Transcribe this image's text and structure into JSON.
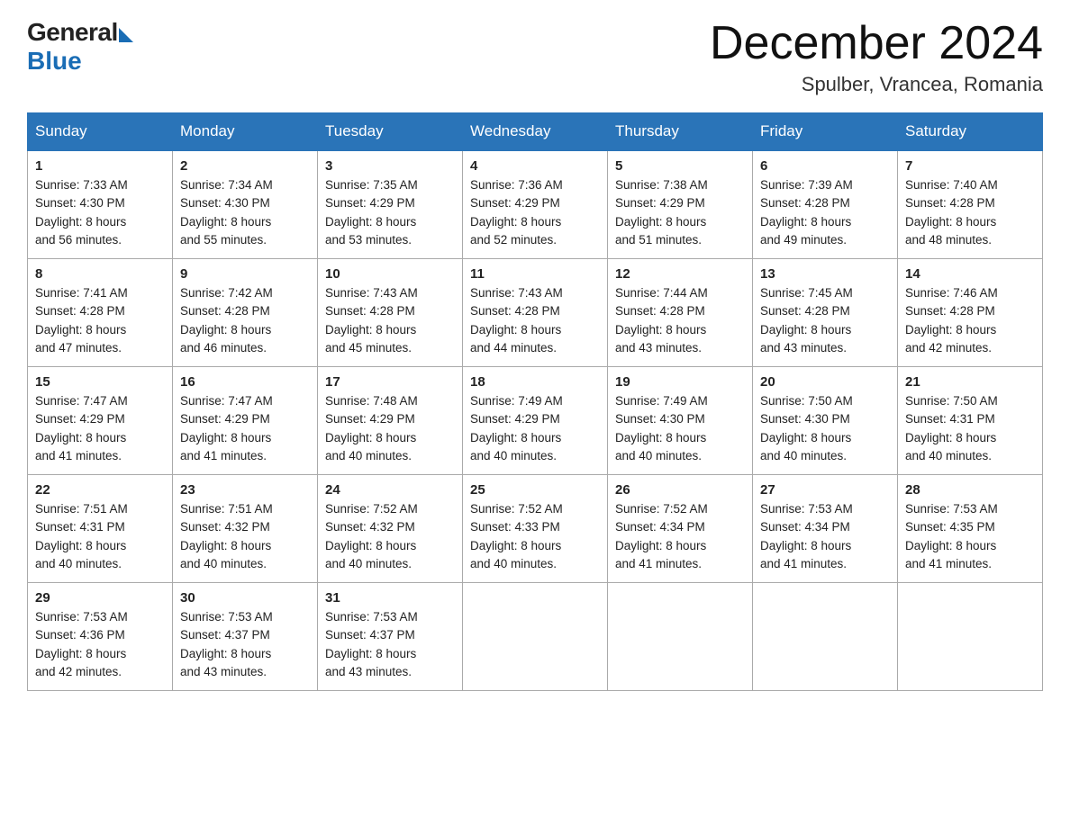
{
  "header": {
    "month_title": "December 2024",
    "location": "Spulber, Vrancea, Romania",
    "logo_general": "General",
    "logo_blue": "Blue"
  },
  "days_of_week": [
    "Sunday",
    "Monday",
    "Tuesday",
    "Wednesday",
    "Thursday",
    "Friday",
    "Saturday"
  ],
  "weeks": [
    [
      {
        "day": "1",
        "sunrise": "7:33 AM",
        "sunset": "4:30 PM",
        "daylight": "8 hours and 56 minutes."
      },
      {
        "day": "2",
        "sunrise": "7:34 AM",
        "sunset": "4:30 PM",
        "daylight": "8 hours and 55 minutes."
      },
      {
        "day": "3",
        "sunrise": "7:35 AM",
        "sunset": "4:29 PM",
        "daylight": "8 hours and 53 minutes."
      },
      {
        "day": "4",
        "sunrise": "7:36 AM",
        "sunset": "4:29 PM",
        "daylight": "8 hours and 52 minutes."
      },
      {
        "day": "5",
        "sunrise": "7:38 AM",
        "sunset": "4:29 PM",
        "daylight": "8 hours and 51 minutes."
      },
      {
        "day": "6",
        "sunrise": "7:39 AM",
        "sunset": "4:28 PM",
        "daylight": "8 hours and 49 minutes."
      },
      {
        "day": "7",
        "sunrise": "7:40 AM",
        "sunset": "4:28 PM",
        "daylight": "8 hours and 48 minutes."
      }
    ],
    [
      {
        "day": "8",
        "sunrise": "7:41 AM",
        "sunset": "4:28 PM",
        "daylight": "8 hours and 47 minutes."
      },
      {
        "day": "9",
        "sunrise": "7:42 AM",
        "sunset": "4:28 PM",
        "daylight": "8 hours and 46 minutes."
      },
      {
        "day": "10",
        "sunrise": "7:43 AM",
        "sunset": "4:28 PM",
        "daylight": "8 hours and 45 minutes."
      },
      {
        "day": "11",
        "sunrise": "7:43 AM",
        "sunset": "4:28 PM",
        "daylight": "8 hours and 44 minutes."
      },
      {
        "day": "12",
        "sunrise": "7:44 AM",
        "sunset": "4:28 PM",
        "daylight": "8 hours and 43 minutes."
      },
      {
        "day": "13",
        "sunrise": "7:45 AM",
        "sunset": "4:28 PM",
        "daylight": "8 hours and 43 minutes."
      },
      {
        "day": "14",
        "sunrise": "7:46 AM",
        "sunset": "4:28 PM",
        "daylight": "8 hours and 42 minutes."
      }
    ],
    [
      {
        "day": "15",
        "sunrise": "7:47 AM",
        "sunset": "4:29 PM",
        "daylight": "8 hours and 41 minutes."
      },
      {
        "day": "16",
        "sunrise": "7:47 AM",
        "sunset": "4:29 PM",
        "daylight": "8 hours and 41 minutes."
      },
      {
        "day": "17",
        "sunrise": "7:48 AM",
        "sunset": "4:29 PM",
        "daylight": "8 hours and 40 minutes."
      },
      {
        "day": "18",
        "sunrise": "7:49 AM",
        "sunset": "4:29 PM",
        "daylight": "8 hours and 40 minutes."
      },
      {
        "day": "19",
        "sunrise": "7:49 AM",
        "sunset": "4:30 PM",
        "daylight": "8 hours and 40 minutes."
      },
      {
        "day": "20",
        "sunrise": "7:50 AM",
        "sunset": "4:30 PM",
        "daylight": "8 hours and 40 minutes."
      },
      {
        "day": "21",
        "sunrise": "7:50 AM",
        "sunset": "4:31 PM",
        "daylight": "8 hours and 40 minutes."
      }
    ],
    [
      {
        "day": "22",
        "sunrise": "7:51 AM",
        "sunset": "4:31 PM",
        "daylight": "8 hours and 40 minutes."
      },
      {
        "day": "23",
        "sunrise": "7:51 AM",
        "sunset": "4:32 PM",
        "daylight": "8 hours and 40 minutes."
      },
      {
        "day": "24",
        "sunrise": "7:52 AM",
        "sunset": "4:32 PM",
        "daylight": "8 hours and 40 minutes."
      },
      {
        "day": "25",
        "sunrise": "7:52 AM",
        "sunset": "4:33 PM",
        "daylight": "8 hours and 40 minutes."
      },
      {
        "day": "26",
        "sunrise": "7:52 AM",
        "sunset": "4:34 PM",
        "daylight": "8 hours and 41 minutes."
      },
      {
        "day": "27",
        "sunrise": "7:53 AM",
        "sunset": "4:34 PM",
        "daylight": "8 hours and 41 minutes."
      },
      {
        "day": "28",
        "sunrise": "7:53 AM",
        "sunset": "4:35 PM",
        "daylight": "8 hours and 41 minutes."
      }
    ],
    [
      {
        "day": "29",
        "sunrise": "7:53 AM",
        "sunset": "4:36 PM",
        "daylight": "8 hours and 42 minutes."
      },
      {
        "day": "30",
        "sunrise": "7:53 AM",
        "sunset": "4:37 PM",
        "daylight": "8 hours and 43 minutes."
      },
      {
        "day": "31",
        "sunrise": "7:53 AM",
        "sunset": "4:37 PM",
        "daylight": "8 hours and 43 minutes."
      },
      null,
      null,
      null,
      null
    ]
  ],
  "labels": {
    "sunrise_prefix": "Sunrise: ",
    "sunset_prefix": "Sunset: ",
    "daylight_prefix": "Daylight: "
  }
}
